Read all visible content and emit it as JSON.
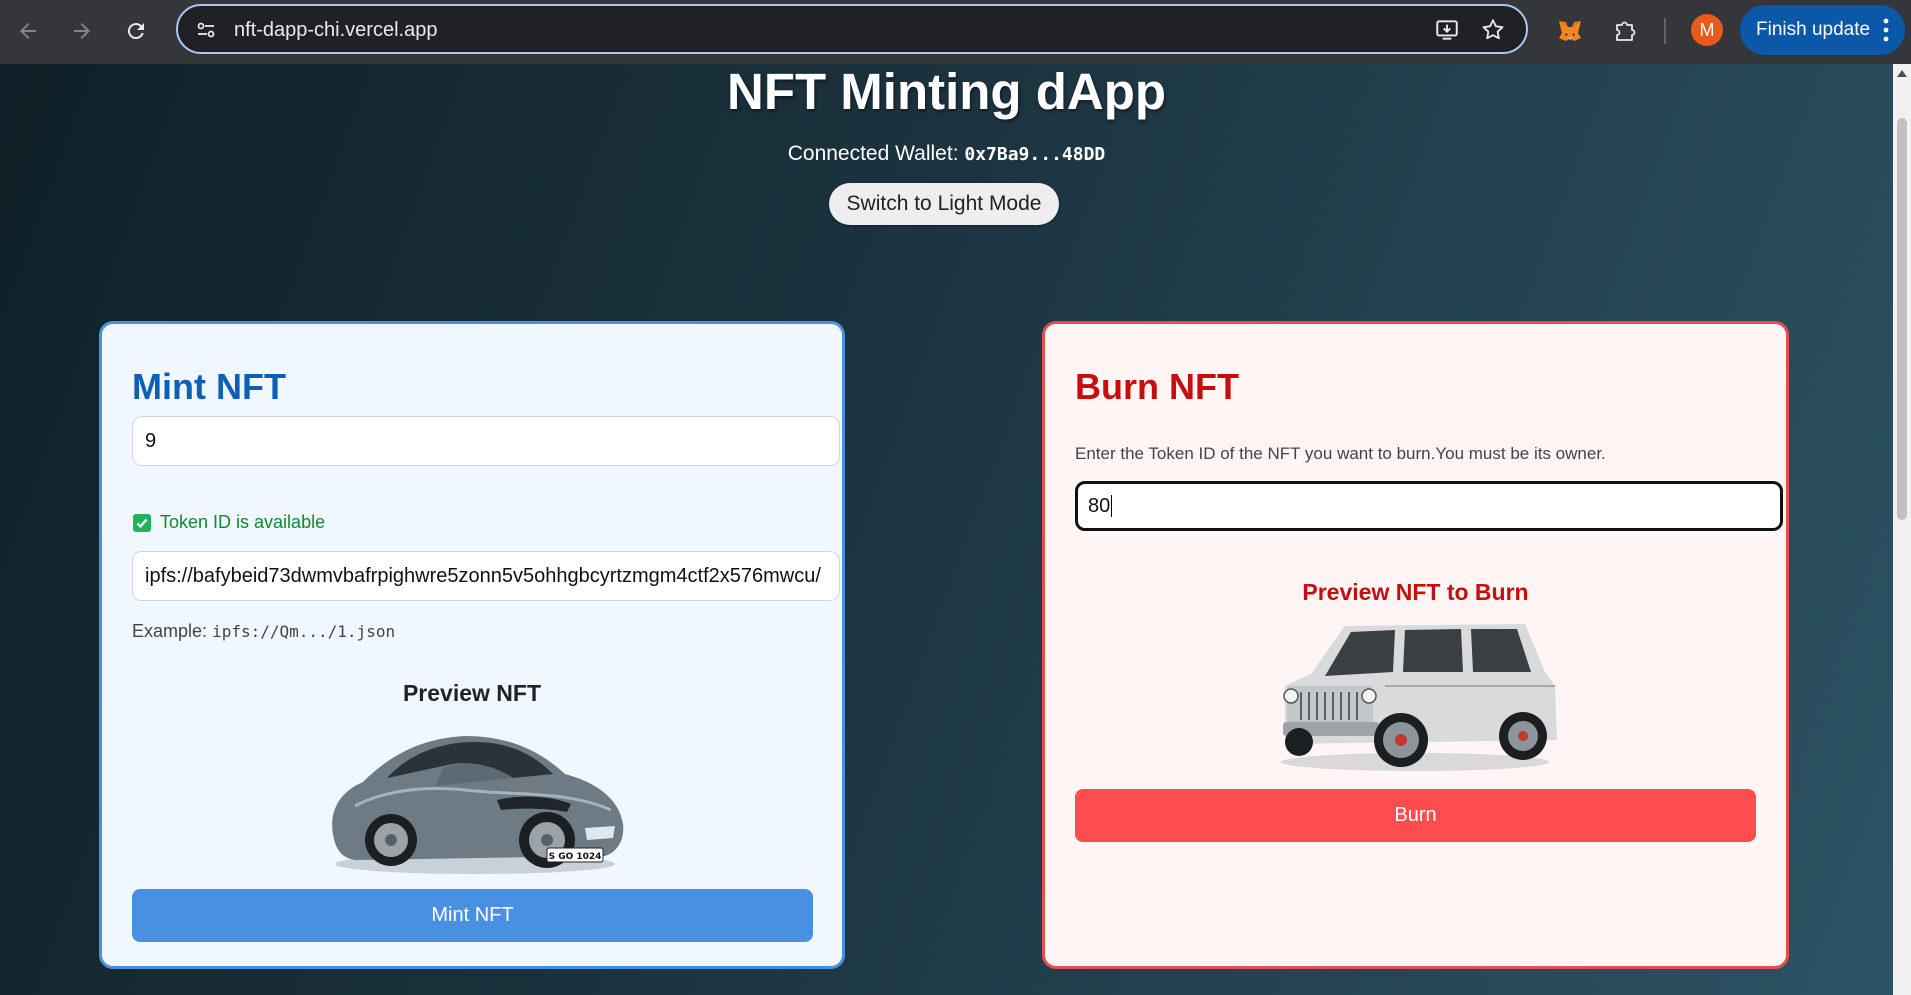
{
  "browser": {
    "url": "nft-dapp-chi.vercel.app",
    "profile_initial": "M",
    "finish_update_label": "Finish update",
    "icons": [
      "back-arrow-icon",
      "forward-arrow-icon",
      "reload-icon",
      "site-info-icon",
      "install-app-icon",
      "bookmark-star-icon",
      "metamask-fox-icon",
      "extensions-puzzle-icon",
      "more-vert-icon"
    ]
  },
  "header": {
    "title": "NFT Minting dApp",
    "wallet_label": "Connected Wallet:",
    "wallet_address": "0x7Ba9...48DD",
    "mode_button": "Switch to Light Mode"
  },
  "mint": {
    "heading": "Mint NFT",
    "token_id_value": "9",
    "availability": "Token ID is available",
    "uri_value": "ipfs://bafybeid73dwmvbafrpighwre5zonn5v5ohhgbcyrtzmgm4ctf2x576mwcu/",
    "example_label": "Example:",
    "example_code": "ipfs://Qm.../1.json",
    "preview_title": "Preview NFT",
    "plate_text": "S GO 1024",
    "button": "Mint NFT"
  },
  "burn": {
    "heading": "Burn NFT",
    "description": "Enter the Token ID of the NFT you want to burn.You must be its owner.",
    "token_id_value": "80",
    "preview_title": "Preview NFT to Burn",
    "button": "Burn"
  },
  "colors": {
    "mint_accent": "#4a90e2",
    "mint_heading": "#0d5fb8",
    "burn_accent": "#ff4d4f",
    "burn_heading": "#c70e0e",
    "available_green": "#12892b"
  }
}
